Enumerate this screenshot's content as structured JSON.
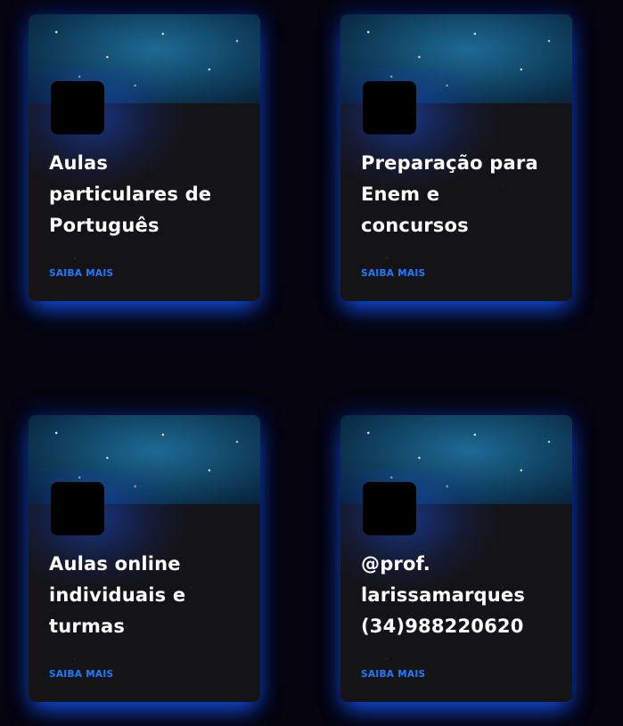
{
  "cards": [
    {
      "title": "Aulas\nparticulares de\nPortuguês",
      "link": "SAIBA MAIS"
    },
    {
      "title": "Preparação para\nEnem e\nconcursos",
      "link": "SAIBA MAIS"
    },
    {
      "title": "Aulas online\nindividuais e\nturmas",
      "link": "SAIBA MAIS"
    },
    {
      "title": "@prof.\nlarissamarques\n(34)988220620",
      "link": "SAIBA MAIS"
    }
  ],
  "colors": {
    "background": "#05040f",
    "card": "#141417",
    "accent_link": "#1e7bff",
    "glow": "#1e5aff"
  }
}
